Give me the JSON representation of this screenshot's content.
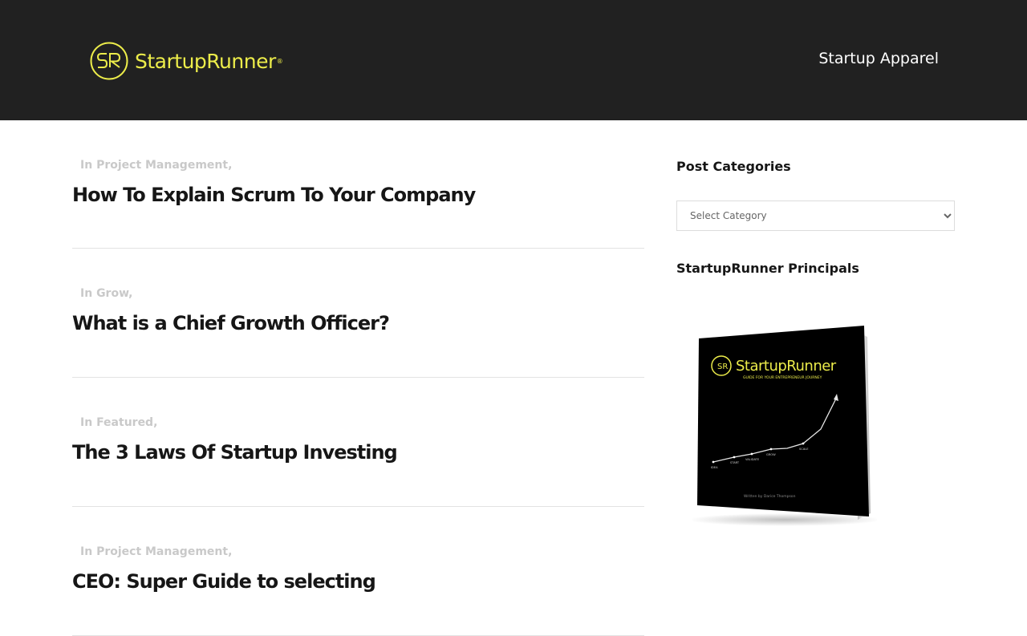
{
  "header": {
    "logo_text": "StartupRunner",
    "logo_reg": "®",
    "logo_monogram": "SR",
    "nav_link": "Startup Apparel"
  },
  "posts": [
    {
      "meta_prefix": "In",
      "category": "Project Management",
      "separator": ",",
      "title": "How To Explain Scrum To Your Company"
    },
    {
      "meta_prefix": "In",
      "category": "Grow",
      "separator": ",",
      "title": "What is a Chief Growth Officer?"
    },
    {
      "meta_prefix": "In",
      "category": "Featured",
      "separator": ",",
      "title": "The 3 Laws Of Startup Investing"
    },
    {
      "meta_prefix": "In",
      "category": "Project Management",
      "separator": ",",
      "title": "CEO: Super Guide to selecting"
    }
  ],
  "sidebar": {
    "categories_title": "Post Categories",
    "select_placeholder": "Select Category",
    "principals_title": "StartupRunner Principals",
    "book": {
      "brand": "StartupRunner",
      "subtitle": "GUIDE FOR YOUR ENTREPRENEUR JOURNEY",
      "stages": [
        "IDEA",
        "START",
        "VALIDATE",
        "GROW",
        "SCALE"
      ],
      "author": "Written by Darice Thompson"
    }
  },
  "colors": {
    "header_bg": "#212121",
    "brand_yellow": "#ecec4a",
    "meta_gray": "#c9c9c9",
    "title_dark": "#161616"
  }
}
